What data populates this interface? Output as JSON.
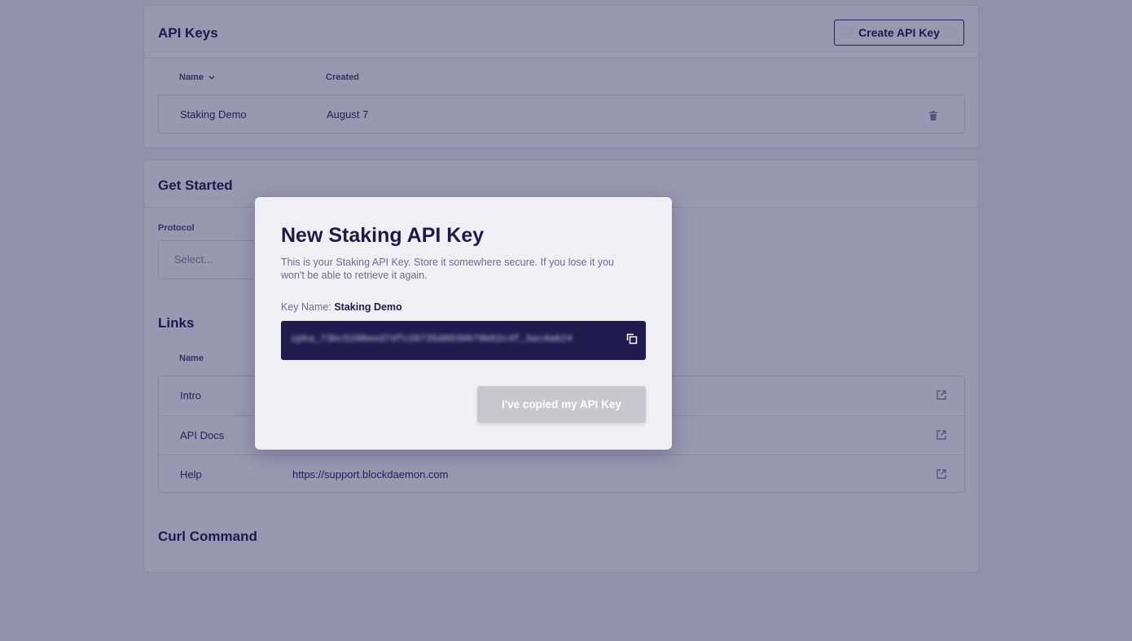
{
  "api_keys": {
    "title": "API Keys",
    "create_label": "Create API Key",
    "columns": {
      "name": "Name",
      "created": "Created"
    },
    "rows": [
      {
        "name": "Staking Demo",
        "created": "August 7"
      }
    ]
  },
  "get_started": {
    "title": "Get Started",
    "protocol_label": "Protocol",
    "protocol_placeholder": "Select..."
  },
  "links": {
    "title": "Links",
    "column_name": "Name",
    "rows": [
      {
        "name": "Intro",
        "url": ""
      },
      {
        "name": "API Docs",
        "url": ""
      },
      {
        "name": "Help",
        "url": "https://support.blockdaemon.com"
      }
    ]
  },
  "curl": {
    "title": "Curl Command"
  },
  "modal": {
    "title": "New Staking API Key",
    "description": "This is your Staking API Key. Store it somewhere secure. If you lose it you won't be able to retrieve it again.",
    "key_name_label": "Key Name:",
    "key_name_value": "Staking Demo",
    "api_key_value": "zpka_73bc5208eed74fc28735d8930079b62c4f_3ac4a624",
    "confirm_label": "I've copied my API Key"
  },
  "colors": {
    "primary_dark": "#211a4e",
    "overlay": "rgba(30,24,80,0.45)",
    "disabled_button": "#c8c7ce"
  }
}
